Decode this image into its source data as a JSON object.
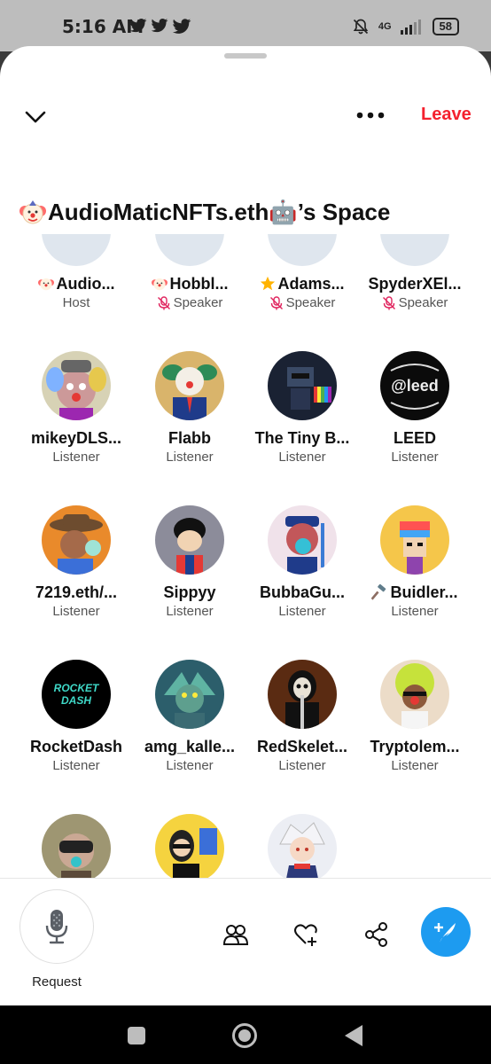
{
  "status_bar": {
    "time": "5:16 AM",
    "network": "4G",
    "battery": "58"
  },
  "header": {
    "leave_label": "Leave"
  },
  "space": {
    "title": "AudioMaticNFTs.eth🤖’s Space"
  },
  "participants": [
    {
      "name": "Audio...",
      "role": "Host",
      "badge": "clown",
      "muted": false,
      "avatar": ""
    },
    {
      "name": "Hobbl...",
      "role": "Speaker",
      "badge": "clown",
      "muted": true,
      "avatar": ""
    },
    {
      "name": "Adams...",
      "role": "Speaker",
      "badge": "star",
      "muted": true,
      "avatar": ""
    },
    {
      "name": "SpyderXEl...",
      "role": "Speaker",
      "badge": "",
      "muted": true,
      "avatar": ""
    },
    {
      "name": "mikeyDLS...",
      "role": "Listener",
      "badge": "",
      "avatar": "ape-clown"
    },
    {
      "name": "Flabb",
      "role": "Listener",
      "badge": "",
      "avatar": "clown-suit"
    },
    {
      "name": "The Tiny B...",
      "role": "Listener",
      "badge": "",
      "avatar": "pixel-robot"
    },
    {
      "name": "LEED",
      "role": "Listener",
      "badge": "",
      "avatar": "leed-logo"
    },
    {
      "name": "7219.eth/...",
      "role": "Listener",
      "badge": "",
      "avatar": "ape-cowboy"
    },
    {
      "name": "Sippyy",
      "role": "Listener",
      "badge": "",
      "avatar": "cartoon-dog"
    },
    {
      "name": "BubbaGu...",
      "role": "Listener",
      "badge": "",
      "avatar": "ape-captain"
    },
    {
      "name": "Buidler...",
      "role": "Listener",
      "badge": "hammer",
      "avatar": "pixel-punk"
    },
    {
      "name": "RocketDash",
      "role": "Listener",
      "badge": "",
      "avatar": "rocketdash-logo"
    },
    {
      "name": "amg_kalle...",
      "role": "Listener",
      "badge": "",
      "avatar": "dragon"
    },
    {
      "name": "RedSkelet...",
      "role": "Listener",
      "badge": "",
      "avatar": "skeleton"
    },
    {
      "name": "Tryptolem...",
      "role": "Listener",
      "badge": "",
      "avatar": "afro-clown"
    },
    {
      "name": "",
      "role": "",
      "badge": "",
      "avatar": "vr-ape"
    },
    {
      "name": "",
      "role": "",
      "badge": "",
      "avatar": "glasses-girl"
    },
    {
      "name": "",
      "role": "",
      "badge": "",
      "avatar": "anime-boy"
    }
  ],
  "avatar_text": {
    "rocketdash": "ROCKET DASH",
    "leed": "LEED"
  },
  "bottom_bar": {
    "request_label": "Request"
  },
  "colors": {
    "accent": "#1d9bf0",
    "leave": "#f4212e",
    "muted_icon": "#e0245e"
  }
}
